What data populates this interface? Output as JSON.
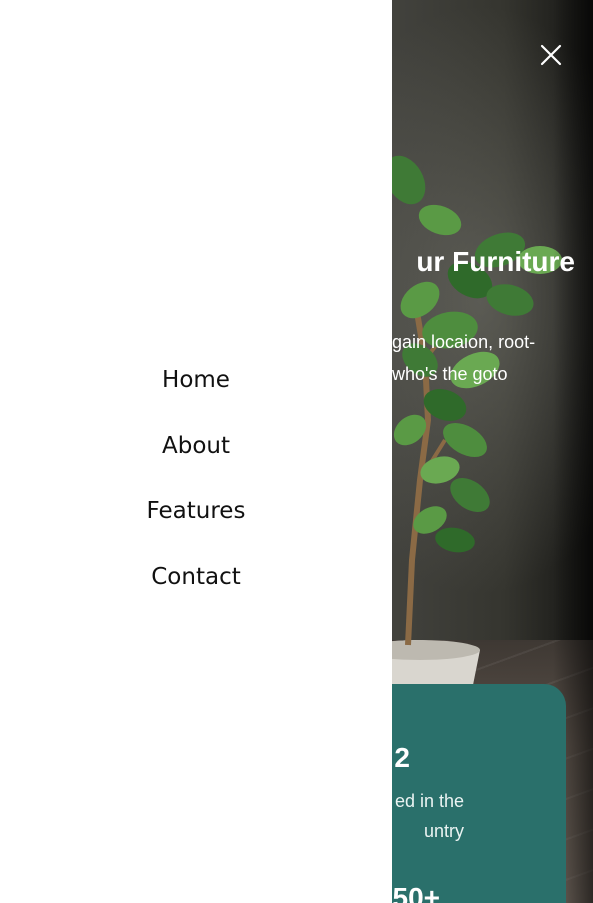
{
  "drawer": {
    "nav_items": [
      {
        "label": "Home"
      },
      {
        "label": "About"
      },
      {
        "label": "Features"
      },
      {
        "label": "Contact"
      }
    ]
  },
  "header": {
    "close_icon": "close-icon"
  },
  "hero": {
    "title": "ur Furniture",
    "description_line1": "gain locaion, root-",
    "description_line2": "who's the goto"
  },
  "stats": {
    "stat1_value": "2",
    "stat1_caption_line1": "ed in the",
    "stat1_caption_line2": "untry",
    "stat2_value": "50+"
  },
  "colors": {
    "drawer_bg": "#ffffff",
    "card_teal": "#2a706b",
    "text_white": "#ffffff"
  }
}
